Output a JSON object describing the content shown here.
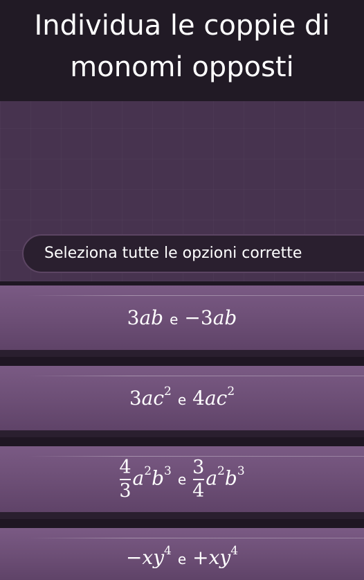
{
  "header": {
    "title_line1": "Individua le coppie di",
    "title_line2": "monomi opposti"
  },
  "instruction": "Seleziona tutte le opzioni corrette",
  "connector": "e",
  "options": [
    {
      "left": "3ab",
      "right": "−3ab"
    },
    {
      "left": "3ac²",
      "right": "4ac²"
    },
    {
      "left": "4/3 a²b³",
      "right": "3/4 a²b³"
    },
    {
      "left": "−xy⁴",
      "right": "+xy⁴"
    }
  ],
  "colors": {
    "header_bg": "#211a25",
    "main_bg": "#47334f",
    "option_bg": "#6c4e75",
    "pill_bg": "#2a1f2f",
    "text": "#ffffff"
  }
}
